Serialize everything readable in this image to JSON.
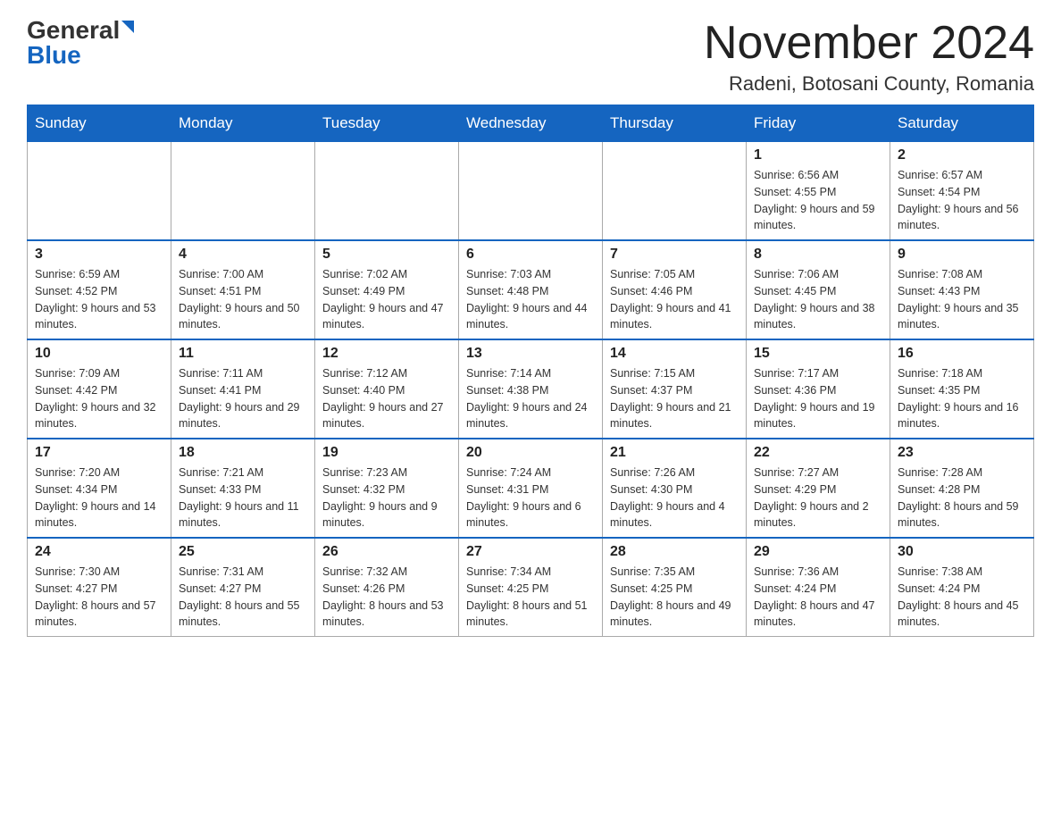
{
  "header": {
    "logo_general": "General",
    "logo_blue": "Blue",
    "month": "November 2024",
    "location": "Radeni, Botosani County, Romania"
  },
  "days_of_week": [
    "Sunday",
    "Monday",
    "Tuesday",
    "Wednesday",
    "Thursday",
    "Friday",
    "Saturday"
  ],
  "weeks": [
    [
      {
        "day": "",
        "info": ""
      },
      {
        "day": "",
        "info": ""
      },
      {
        "day": "",
        "info": ""
      },
      {
        "day": "",
        "info": ""
      },
      {
        "day": "",
        "info": ""
      },
      {
        "day": "1",
        "info": "Sunrise: 6:56 AM\nSunset: 4:55 PM\nDaylight: 9 hours and 59 minutes."
      },
      {
        "day": "2",
        "info": "Sunrise: 6:57 AM\nSunset: 4:54 PM\nDaylight: 9 hours and 56 minutes."
      }
    ],
    [
      {
        "day": "3",
        "info": "Sunrise: 6:59 AM\nSunset: 4:52 PM\nDaylight: 9 hours and 53 minutes."
      },
      {
        "day": "4",
        "info": "Sunrise: 7:00 AM\nSunset: 4:51 PM\nDaylight: 9 hours and 50 minutes."
      },
      {
        "day": "5",
        "info": "Sunrise: 7:02 AM\nSunset: 4:49 PM\nDaylight: 9 hours and 47 minutes."
      },
      {
        "day": "6",
        "info": "Sunrise: 7:03 AM\nSunset: 4:48 PM\nDaylight: 9 hours and 44 minutes."
      },
      {
        "day": "7",
        "info": "Sunrise: 7:05 AM\nSunset: 4:46 PM\nDaylight: 9 hours and 41 minutes."
      },
      {
        "day": "8",
        "info": "Sunrise: 7:06 AM\nSunset: 4:45 PM\nDaylight: 9 hours and 38 minutes."
      },
      {
        "day": "9",
        "info": "Sunrise: 7:08 AM\nSunset: 4:43 PM\nDaylight: 9 hours and 35 minutes."
      }
    ],
    [
      {
        "day": "10",
        "info": "Sunrise: 7:09 AM\nSunset: 4:42 PM\nDaylight: 9 hours and 32 minutes."
      },
      {
        "day": "11",
        "info": "Sunrise: 7:11 AM\nSunset: 4:41 PM\nDaylight: 9 hours and 29 minutes."
      },
      {
        "day": "12",
        "info": "Sunrise: 7:12 AM\nSunset: 4:40 PM\nDaylight: 9 hours and 27 minutes."
      },
      {
        "day": "13",
        "info": "Sunrise: 7:14 AM\nSunset: 4:38 PM\nDaylight: 9 hours and 24 minutes."
      },
      {
        "day": "14",
        "info": "Sunrise: 7:15 AM\nSunset: 4:37 PM\nDaylight: 9 hours and 21 minutes."
      },
      {
        "day": "15",
        "info": "Sunrise: 7:17 AM\nSunset: 4:36 PM\nDaylight: 9 hours and 19 minutes."
      },
      {
        "day": "16",
        "info": "Sunrise: 7:18 AM\nSunset: 4:35 PM\nDaylight: 9 hours and 16 minutes."
      }
    ],
    [
      {
        "day": "17",
        "info": "Sunrise: 7:20 AM\nSunset: 4:34 PM\nDaylight: 9 hours and 14 minutes."
      },
      {
        "day": "18",
        "info": "Sunrise: 7:21 AM\nSunset: 4:33 PM\nDaylight: 9 hours and 11 minutes."
      },
      {
        "day": "19",
        "info": "Sunrise: 7:23 AM\nSunset: 4:32 PM\nDaylight: 9 hours and 9 minutes."
      },
      {
        "day": "20",
        "info": "Sunrise: 7:24 AM\nSunset: 4:31 PM\nDaylight: 9 hours and 6 minutes."
      },
      {
        "day": "21",
        "info": "Sunrise: 7:26 AM\nSunset: 4:30 PM\nDaylight: 9 hours and 4 minutes."
      },
      {
        "day": "22",
        "info": "Sunrise: 7:27 AM\nSunset: 4:29 PM\nDaylight: 9 hours and 2 minutes."
      },
      {
        "day": "23",
        "info": "Sunrise: 7:28 AM\nSunset: 4:28 PM\nDaylight: 8 hours and 59 minutes."
      }
    ],
    [
      {
        "day": "24",
        "info": "Sunrise: 7:30 AM\nSunset: 4:27 PM\nDaylight: 8 hours and 57 minutes."
      },
      {
        "day": "25",
        "info": "Sunrise: 7:31 AM\nSunset: 4:27 PM\nDaylight: 8 hours and 55 minutes."
      },
      {
        "day": "26",
        "info": "Sunrise: 7:32 AM\nSunset: 4:26 PM\nDaylight: 8 hours and 53 minutes."
      },
      {
        "day": "27",
        "info": "Sunrise: 7:34 AM\nSunset: 4:25 PM\nDaylight: 8 hours and 51 minutes."
      },
      {
        "day": "28",
        "info": "Sunrise: 7:35 AM\nSunset: 4:25 PM\nDaylight: 8 hours and 49 minutes."
      },
      {
        "day": "29",
        "info": "Sunrise: 7:36 AM\nSunset: 4:24 PM\nDaylight: 8 hours and 47 minutes."
      },
      {
        "day": "30",
        "info": "Sunrise: 7:38 AM\nSunset: 4:24 PM\nDaylight: 8 hours and 45 minutes."
      }
    ]
  ]
}
